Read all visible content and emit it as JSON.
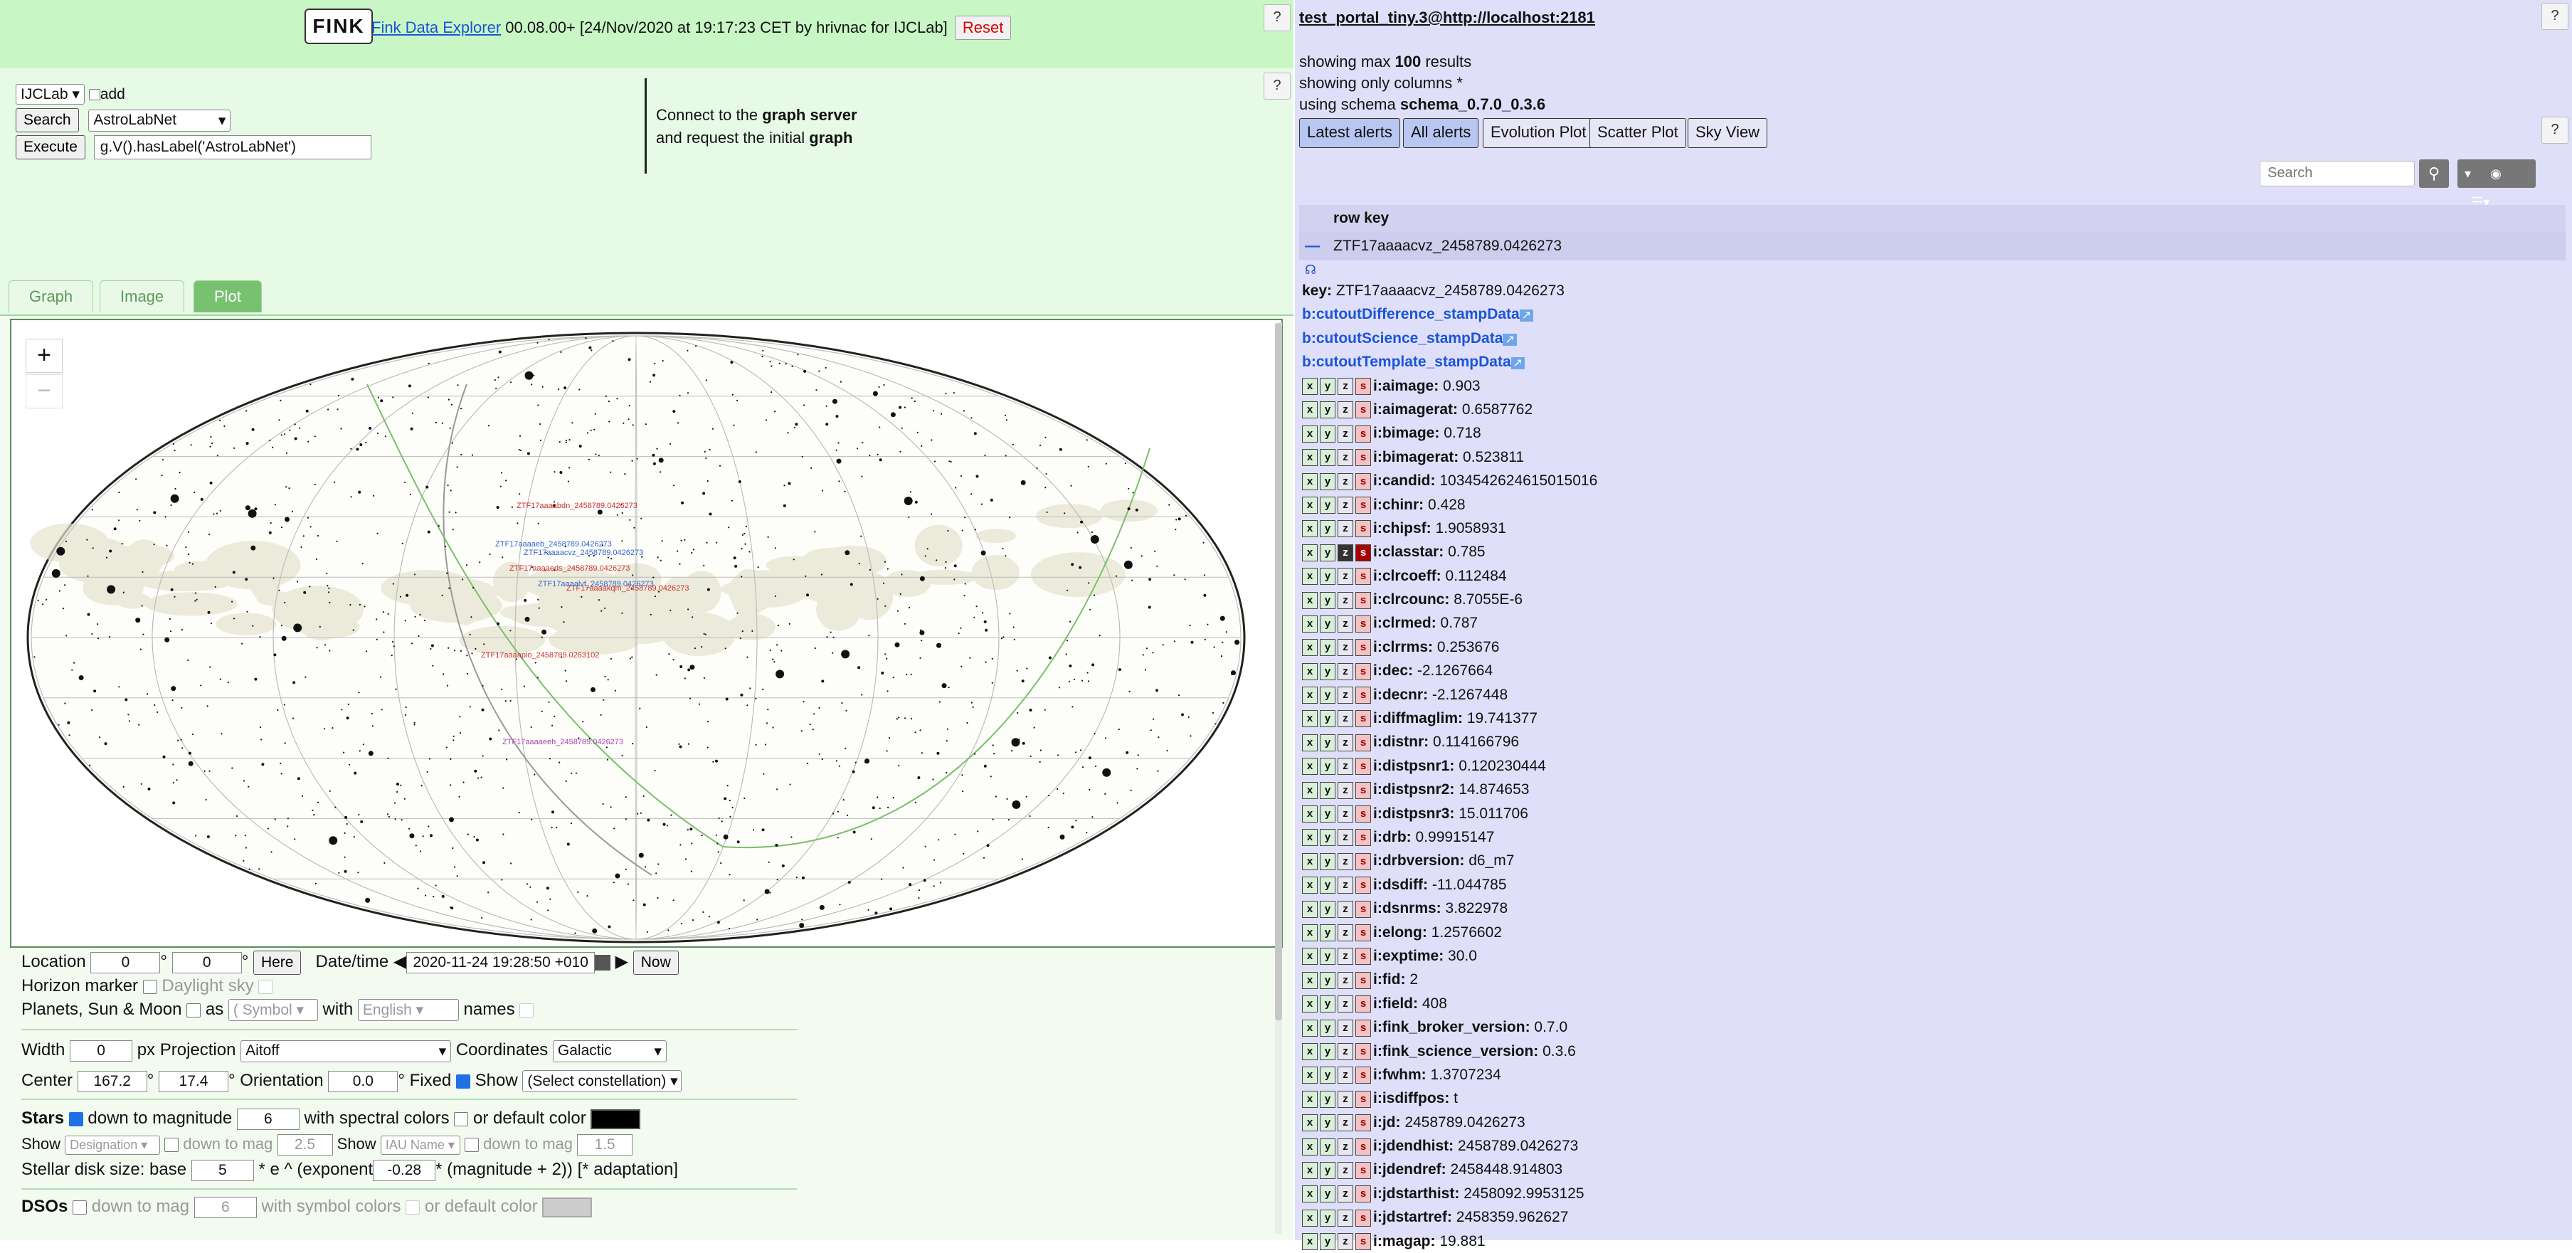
{
  "header": {
    "logo_text": "FINK",
    "app_link": "Fink Data Explorer",
    "version_text": " 00.08.00+ [24/Nov/2020 at 19:17:23 CET by hrivnac for IJCLab]",
    "reset_label": "Reset",
    "help_label": "?"
  },
  "connect": {
    "server_select": "IJCLab",
    "add_label": "add",
    "search_label": "Search",
    "search_select": "AstroLabNet",
    "execute_label": "Execute",
    "query_value": "g.V().hasLabel('AstroLabNet')",
    "msg_line1_pre": "Connect to the ",
    "msg_line1_bold": "graph server",
    "msg_line2_pre": "and request the initial ",
    "msg_line2_bold": "graph"
  },
  "tabs": [
    "Graph",
    "Image",
    "Plot"
  ],
  "sky": {
    "zoom_in": "+",
    "zoom_out": "−",
    "labels": [
      "ZTF17aaaabdn_2458789.0426273",
      "ZTF17aaaacvz_2458789.0426273",
      "ZTF17aaaaeb_2458789.0426273",
      "ZTF17aaaaeds_2458789.0426273",
      "ZTF17aaaakqm_2458789.0426273",
      "ZTF17aaaalvf_2458789.0426273",
      "ZTF17aaaapio_2458789.0263102",
      "ZTF17aaaaeeh_2458789.0426273"
    ]
  },
  "controls": {
    "location_label": "Location",
    "lon": "0",
    "lat": "0",
    "here_label": "Here",
    "datetime_label": "Date/time",
    "datetime_value": "2020-11-24 19:28:50 +010",
    "now_label": "Now",
    "horizon_label": "Horizon marker",
    "daylight_label": "Daylight sky",
    "planets_label": "Planets, Sun & Moon",
    "as_label": "as",
    "symbol_select": "( Symbol",
    "with_label": "with",
    "lang_select": "English",
    "names_label": "names",
    "width_label": "Width",
    "width_value": "0",
    "px_label": "px",
    "projection_label": "Projection",
    "projection_value": "Aitoff",
    "coordinates_label": "Coordinates",
    "coordinates_value": "Galactic",
    "center_label": "Center",
    "center_lon": "167.2",
    "center_lat": "17.4",
    "orientation_label": "Orientation",
    "orientation_value": "0.0",
    "fixed_label": "Fixed",
    "show_label": "Show",
    "constellation_select": "(Select constellation)",
    "stars_label": "Stars",
    "down_to_mag_label": "down to magnitude",
    "stars_mag": "6",
    "spectral_label": "with spectral colors",
    "default_color_label": "or default color",
    "show2_label": "Show",
    "designation_select": "Designation",
    "down_to_mag2": "down to mag",
    "mag2": "2.5",
    "show3_label": "Show",
    "iau_select": "IAU Name",
    "down_to_mag3": "down to mag",
    "mag3": "1.5",
    "disk_label_pre": "Stellar disk size: base",
    "disk_base": "5",
    "disk_mid": "* e ^ (exponent",
    "disk_exp": "-0.28",
    "disk_post": "* (magnitude + 2)) [* adaptation]",
    "dsos_label": "DSOs",
    "dso_down": "down to mag",
    "dso_mag": "6",
    "dso_symbol": "with symbol colors",
    "dso_default": "or default color"
  },
  "right": {
    "table_name": "test_portal_tiny.3@http://localhost:2181",
    "max_pre": "showing max ",
    "max_value": "100",
    "max_post": " results",
    "cols_text": "showing only columns *",
    "schema_pre": "using schema ",
    "schema_value": "schema_0.7.0_0.3.6",
    "buttons": [
      "Latest alerts",
      "All alerts",
      "Evolution Plot",
      "Scatter Plot",
      "Sky View"
    ],
    "search_placeholder": "Search",
    "column_header": "row key",
    "selected_row": "ZTF17aaaacvz_2458789.0426273",
    "collapse_symbol": "—",
    "key_label": "key:",
    "key_value": "ZTF17aaaacvz_2458789.0426273",
    "links": [
      "b:cutoutDifference_stampData",
      "b:cutoutScience_stampData",
      "b:cutoutTemplate_stampData"
    ],
    "attributes": [
      [
        "i:aimage:",
        "0.903"
      ],
      [
        "i:aimagerat:",
        "0.6587762"
      ],
      [
        "i:bimage:",
        "0.718"
      ],
      [
        "i:bimagerat:",
        "0.523811"
      ],
      [
        "i:candid:",
        "1034542624615015016"
      ],
      [
        "i:chinr:",
        "0.428"
      ],
      [
        "i:chipsf:",
        "1.9058931"
      ],
      [
        "i:classtar:",
        "0.785"
      ],
      [
        "i:clrcoeff:",
        "0.112484"
      ],
      [
        "i:clrcounc:",
        "8.7055E-6"
      ],
      [
        "i:clrmed:",
        "0.787"
      ],
      [
        "i:clrrms:",
        "0.253676"
      ],
      [
        "i:dec:",
        "-2.1267664"
      ],
      [
        "i:decnr:",
        "-2.1267448"
      ],
      [
        "i:diffmaglim:",
        "19.741377"
      ],
      [
        "i:distnr:",
        "0.114166796"
      ],
      [
        "i:distpsnr1:",
        "0.120230444"
      ],
      [
        "i:distpsnr2:",
        "14.874653"
      ],
      [
        "i:distpsnr3:",
        "15.011706"
      ],
      [
        "i:drb:",
        "0.99915147"
      ],
      [
        "i:drbversion:",
        "d6_m7"
      ],
      [
        "i:dsdiff:",
        "-11.044785"
      ],
      [
        "i:dsnrms:",
        "3.822978"
      ],
      [
        "i:elong:",
        "1.2576602"
      ],
      [
        "i:exptime:",
        "30.0"
      ],
      [
        "i:fid:",
        "2"
      ],
      [
        "i:field:",
        "408"
      ],
      [
        "i:fink_broker_version:",
        "0.7.0"
      ],
      [
        "i:fink_science_version:",
        "0.3.6"
      ],
      [
        "i:fwhm:",
        "1.3707234"
      ],
      [
        "i:isdiffpos:",
        "t"
      ],
      [
        "i:jd:",
        "2458789.0426273"
      ],
      [
        "i:jdendhist:",
        "2458789.0426273"
      ],
      [
        "i:jdendref:",
        "2458448.914803"
      ],
      [
        "i:jdstarthist:",
        "2458092.9953125"
      ],
      [
        "i:jdstartref:",
        "2458359.962627"
      ],
      [
        "i:magap:",
        "19.881"
      ]
    ]
  }
}
